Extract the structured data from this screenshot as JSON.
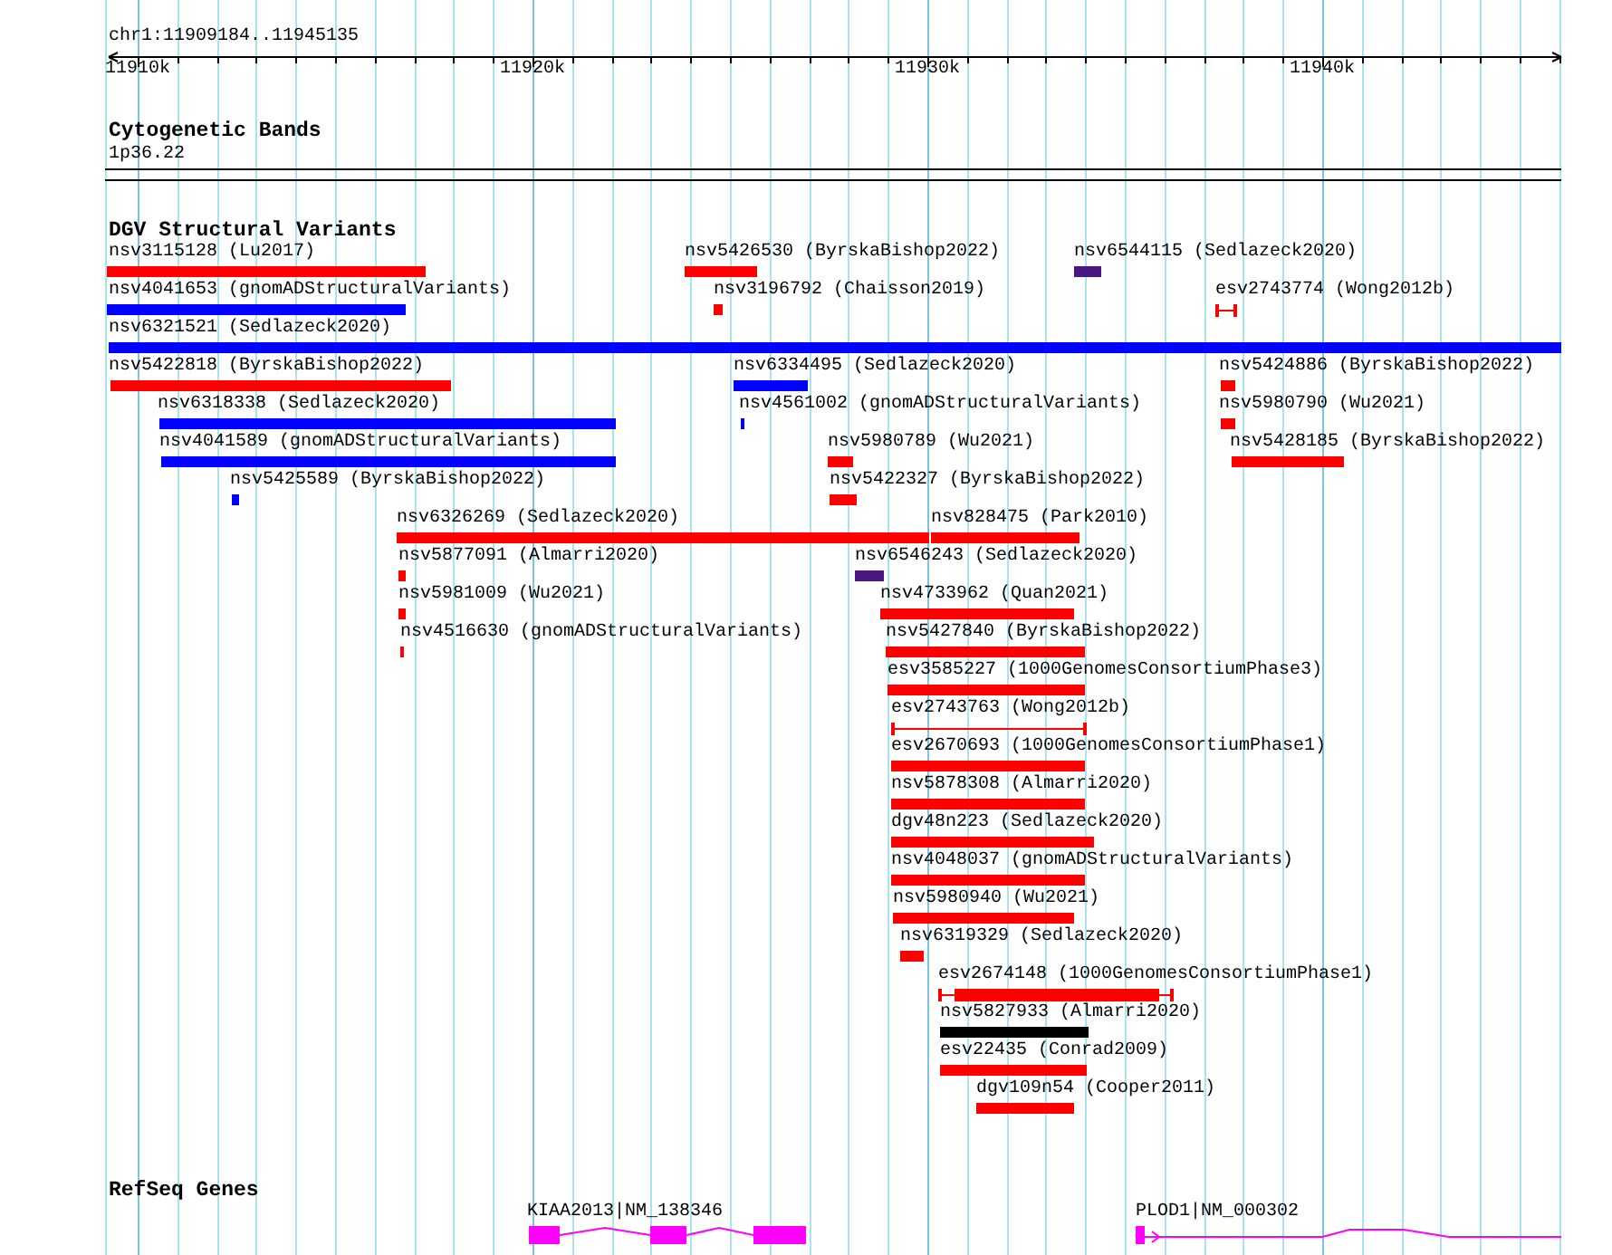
{
  "ruler": {
    "location": "chr1:11909184..11945135",
    "ticks": [
      "11910k",
      "11920k",
      "11930k",
      "11940k"
    ]
  },
  "tracks": [
    {
      "kind": "bands",
      "title": "Cytogenetic Bands",
      "band": "1p36.22"
    },
    {
      "kind": "variants",
      "title": "DGV Structural Variants",
      "features": [
        {
          "label": "nsv3115128 (Lu2017)",
          "color": "#ff0000",
          "kind": "block"
        },
        {
          "label": "nsv5426530 (ByrskaBishop2022)",
          "color": "#ff0000",
          "kind": "block"
        },
        {
          "label": "nsv6544115 (Sedlazeck2020)",
          "color": "#4b1682",
          "kind": "block"
        },
        {
          "label": "nsv4041653 (gnomADStructuralVariants)",
          "color": "#0000ff",
          "kind": "block"
        },
        {
          "label": "nsv3196792 (Chaisson2019)",
          "color": "#ff0000",
          "kind": "block"
        },
        {
          "label": "esv2743774 (Wong2012b)",
          "color": "#ff0000",
          "kind": "range"
        },
        {
          "label": "nsv6321521 (Sedlazeck2020)",
          "color": "#0000ff",
          "kind": "block"
        },
        {
          "label": "nsv5422818 (ByrskaBishop2022)",
          "color": "#ff0000",
          "kind": "block"
        },
        {
          "label": "nsv6334495 (Sedlazeck2020)",
          "color": "#0000ff",
          "kind": "block"
        },
        {
          "label": "nsv5424886 (ByrskaBishop2022)",
          "color": "#ff0000",
          "kind": "block"
        },
        {
          "label": "nsv6318338 (Sedlazeck2020)",
          "color": "#0000ff",
          "kind": "block"
        },
        {
          "label": "nsv4561002 (gnomADStructuralVariants)",
          "color": "#0000ff",
          "kind": "block"
        },
        {
          "label": "nsv5980790 (Wu2021)",
          "color": "#ff0000",
          "kind": "block"
        },
        {
          "label": "nsv4041589 (gnomADStructuralVariants)",
          "color": "#0000ff",
          "kind": "block"
        },
        {
          "label": "nsv5980789 (Wu2021)",
          "color": "#ff0000",
          "kind": "block"
        },
        {
          "label": "nsv5428185 (ByrskaBishop2022)",
          "color": "#ff0000",
          "kind": "block"
        },
        {
          "label": "nsv5425589 (ByrskaBishop2022)",
          "color": "#0000ff",
          "kind": "block"
        },
        {
          "label": "nsv5422327 (ByrskaBishop2022)",
          "color": "#ff0000",
          "kind": "block"
        },
        {
          "label": "nsv6326269 (Sedlazeck2020)",
          "color": "#ff0000",
          "kind": "block"
        },
        {
          "label": "nsv828475 (Park2010)",
          "color": "#ff0000",
          "kind": "block"
        },
        {
          "label": "nsv5877091 (Almarri2020)",
          "color": "#ff0000",
          "kind": "block"
        },
        {
          "label": "nsv6546243 (Sedlazeck2020)",
          "color": "#4b1682",
          "kind": "block"
        },
        {
          "label": "nsv5981009 (Wu2021)",
          "color": "#ff0000",
          "kind": "block"
        },
        {
          "label": "nsv4733962 (Quan2021)",
          "color": "#ff0000",
          "kind": "block"
        },
        {
          "label": "nsv4516630 (gnomADStructuralVariants)",
          "color": "#ff0000",
          "kind": "block"
        },
        {
          "label": "nsv5427840 (ByrskaBishop2022)",
          "color": "#ff0000",
          "kind": "block"
        },
        {
          "label": "esv3585227 (1000GenomesConsortiumPhase3)",
          "color": "#ff0000",
          "kind": "block"
        },
        {
          "label": "esv2743763 (Wong2012b)",
          "color": "#ff0000",
          "kind": "range"
        },
        {
          "label": "esv2670693 (1000GenomesConsortiumPhase1)",
          "color": "#ff0000",
          "kind": "block"
        },
        {
          "label": "nsv5878308 (Almarri2020)",
          "color": "#ff0000",
          "kind": "block"
        },
        {
          "label": "dgv48n223 (Sedlazeck2020)",
          "color": "#ff0000",
          "kind": "block"
        },
        {
          "label": "nsv4048037 (gnomADStructuralVariants)",
          "color": "#ff0000",
          "kind": "block"
        },
        {
          "label": "nsv5980940 (Wu2021)",
          "color": "#ff0000",
          "kind": "block"
        },
        {
          "label": "nsv6319329 (Sedlazeck2020)",
          "color": "#ff0000",
          "kind": "block"
        },
        {
          "label": "esv2674148 (1000GenomesConsortiumPhase1)",
          "color": "#ff0000",
          "kind": "range-block"
        },
        {
          "label": "nsv5827933 (Almarri2020)",
          "color": "#000000",
          "kind": "block"
        },
        {
          "label": "esv22435 (Conrad2009)",
          "color": "#ff0000",
          "kind": "block"
        },
        {
          "label": "dgv109n54 (Cooper2011)",
          "color": "#ff0000",
          "kind": "block"
        }
      ]
    },
    {
      "kind": "genes",
      "title": "RefSeq Genes",
      "genes": [
        {
          "label": "KIAA2013|NM_138346"
        },
        {
          "label": "PLOD1|NM_000302"
        }
      ]
    }
  ]
}
